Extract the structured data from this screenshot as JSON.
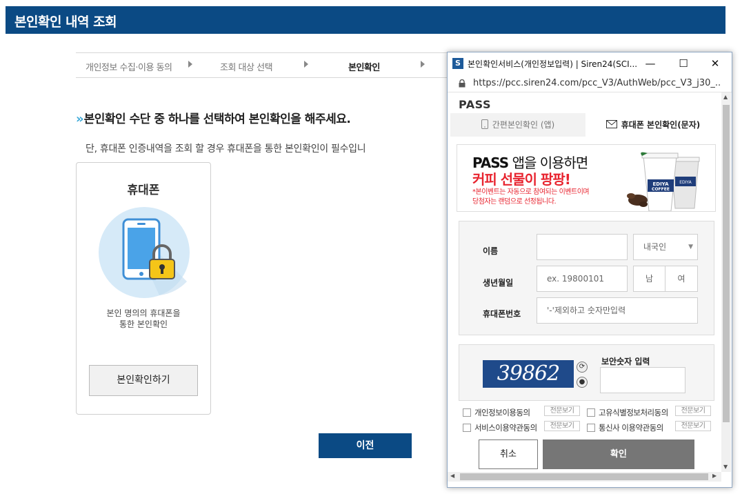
{
  "page": {
    "title": "본인확인 내역 조회",
    "steps": [
      "개인정보 수집·이용 동의",
      "조회 대상 선택",
      "본인확인",
      ""
    ],
    "instruction": "본인확인 수단 중 하나를 선택하여 본인확인을 해주세요.",
    "instruction_marker": "»",
    "note": "단, 휴대폰 인증내역을 조회 할 경우 휴대폰을 통한 본인확인이 필수입니",
    "card": {
      "title": "휴대폰",
      "desc_line1": "본인 명의의 휴대폰을",
      "desc_line2": "통한 본인확인",
      "button": "본인확인하기"
    },
    "prev_button": "이전",
    "colors": {
      "header_bg": "#0b4a84",
      "accent": "#3aa8d8"
    }
  },
  "popup": {
    "window_title": "본인확인서비스(개인정보입력) | Siren24(SCI...",
    "app_icon": "S",
    "controls": {
      "minimize": "—",
      "maximize": "☐",
      "close": "✕"
    },
    "url": "https://pcc.siren24.com/pcc_V3/AuthWeb/pcc_V3_j30_...",
    "logo": "PASS",
    "tabs": [
      {
        "label": "간편본인확인 (앱)",
        "icon": "phone-icon",
        "active": false
      },
      {
        "label": "휴대폰 본인확인(문자)",
        "icon": "envelope-icon",
        "active": true
      }
    ],
    "banner": {
      "line1_pass": "PASS",
      "line1_rest": " 앱을 이용하면",
      "line2": "커피 선물이 팡팡!",
      "note1": "*본이벤트는 자동으로 참여되는 이벤트이며",
      "note2": "당첨자는 랜덤으로 선정됩니다.",
      "cup_text1": "EDIYA",
      "cup_text2": "COFFEE",
      "cup_text3": "EDIYA"
    },
    "form": {
      "name_label": "이름",
      "name_value": "",
      "nationality": "내국인",
      "dob_label": "생년월일",
      "dob_placeholder": "ex. 19800101",
      "gender_male": "남",
      "gender_female": "여",
      "phone_label": "휴대폰번호",
      "phone_placeholder": "'-'제외하고 숫자만입력"
    },
    "captcha": {
      "image_text": "39862",
      "label": "보안숫자 입력",
      "refresh_icon": "refresh-icon",
      "audio_icon": "speaker-icon"
    },
    "agreements": [
      {
        "label": "개인정보이용동의",
        "view": "전문보기"
      },
      {
        "label": "고유식별정보처리동의",
        "view": "전문보기"
      },
      {
        "label": "서비스이용약관동의",
        "view": "전문보기"
      },
      {
        "label": "통신사 이용약관동의",
        "view": "전문보기"
      }
    ],
    "cancel_button": "취소",
    "confirm_button": "확인"
  }
}
